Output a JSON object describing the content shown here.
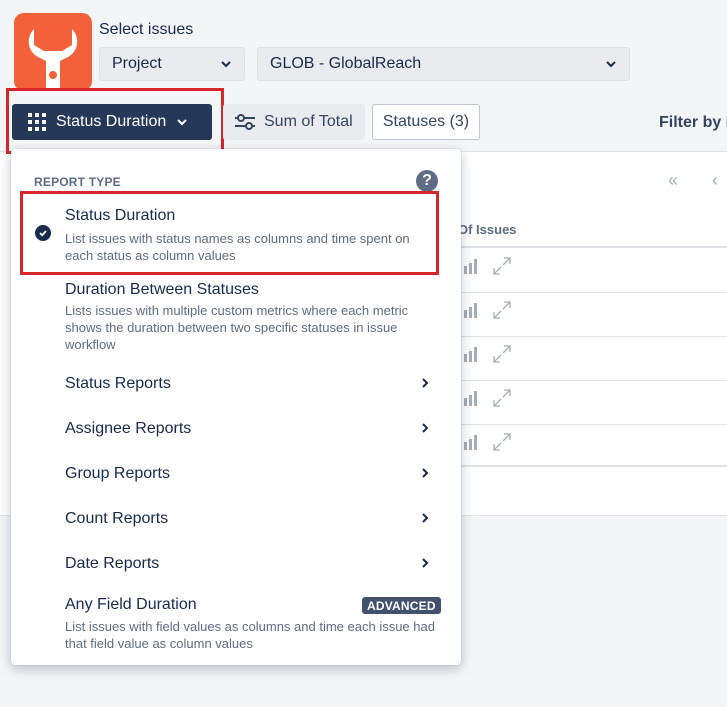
{
  "header": {
    "select_label": "Select issues",
    "scope_select": {
      "value": "Project"
    },
    "project_select": {
      "value": "GLOB - GlobalReach"
    }
  },
  "toolbar": {
    "report_type_button": "Status Duration",
    "sum_button": "Sum of Total",
    "statuses_button": "Statuses (3)",
    "filter_label": "Filter by i"
  },
  "table": {
    "column_header": "Of Issues",
    "nav_first": "«",
    "nav_prev": "‹"
  },
  "menu": {
    "heading": "REPORT TYPE",
    "help_glyph": "?",
    "items": [
      {
        "title": "Status Duration",
        "description": "List issues with status names as columns and time spent on each status as column values",
        "selected": true
      },
      {
        "title": "Duration Between Statuses",
        "description": "Lists issues with multiple custom metrics where each metric shows the duration between two specific statuses in issue workflow"
      },
      {
        "title": "Status Reports"
      },
      {
        "title": "Assignee Reports"
      },
      {
        "title": "Group Reports"
      },
      {
        "title": "Count Reports"
      },
      {
        "title": "Date Reports"
      },
      {
        "title": "Any Field Duration",
        "badge": "ADVANCED",
        "description": "List issues with field values as columns and time each issue had that field value as column values"
      }
    ]
  },
  "icons": {
    "logo": "wrench-icon",
    "submenu": "chevron-right-icon",
    "selected": "check-circle-icon",
    "row_actions": [
      "bar-chart-icon",
      "expand-icon"
    ]
  },
  "colors": {
    "primary": "#253858",
    "highlight": "#d6262c",
    "logo": "#f2613a"
  }
}
